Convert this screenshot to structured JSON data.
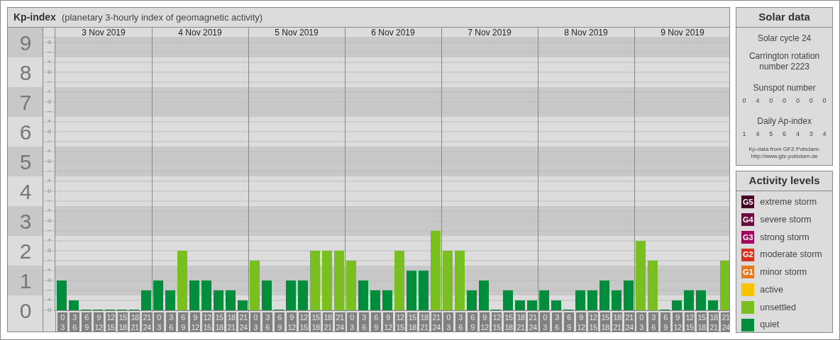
{
  "header": {
    "title": "Kp-index",
    "subtitle": "(planetary 3-hourly index of geomagnetic activity)"
  },
  "chart": {
    "sub_level_marks": [
      "o",
      "−",
      "+",
      "o",
      "−",
      "+",
      "o",
      "−",
      "+",
      "o",
      "−",
      "+",
      "o",
      "−",
      "+",
      "o",
      "−",
      "+",
      "o",
      "−",
      "+",
      "o",
      "−",
      "+",
      "o",
      "−",
      "+",
      "o"
    ],
    "dates": [
      "3 Nov 2019",
      "4 Nov 2019",
      "5 Nov 2019",
      "6 Nov 2019",
      "7 Nov 2019",
      "8 Nov 2019",
      "9 Nov 2019"
    ],
    "hour_labels": [
      [
        "0",
        "3"
      ],
      [
        "3",
        "6"
      ],
      [
        "6",
        "9"
      ],
      [
        "9",
        "12"
      ],
      [
        "12",
        "15"
      ],
      [
        "15",
        "18"
      ],
      [
        "18",
        "21"
      ],
      [
        "21",
        "24"
      ],
      [
        "0",
        "3"
      ],
      [
        "3",
        "6"
      ],
      [
        "6",
        "9"
      ],
      [
        "9",
        "12"
      ],
      [
        "12",
        "15"
      ],
      [
        "15",
        "18"
      ],
      [
        "18",
        "21"
      ],
      [
        "21",
        "24"
      ],
      [
        "0",
        "3"
      ],
      [
        "3",
        "6"
      ],
      [
        "6",
        "9"
      ],
      [
        "9",
        "12"
      ],
      [
        "12",
        "15"
      ],
      [
        "15",
        "18"
      ],
      [
        "18",
        "21"
      ],
      [
        "21",
        "24"
      ],
      [
        "0",
        "3"
      ],
      [
        "3",
        "6"
      ],
      [
        "6",
        "9"
      ],
      [
        "9",
        "12"
      ],
      [
        "12",
        "15"
      ],
      [
        "15",
        "18"
      ],
      [
        "18",
        "21"
      ],
      [
        "21",
        "24"
      ],
      [
        "0",
        "3"
      ],
      [
        "3",
        "6"
      ],
      [
        "6",
        "9"
      ],
      [
        "9",
        "12"
      ],
      [
        "12",
        "15"
      ],
      [
        "15",
        "18"
      ],
      [
        "18",
        "21"
      ],
      [
        "21",
        "24"
      ],
      [
        "0",
        "3"
      ],
      [
        "3",
        "6"
      ],
      [
        "6",
        "9"
      ],
      [
        "9",
        "12"
      ],
      [
        "12",
        "15"
      ],
      [
        "15",
        "18"
      ],
      [
        "18",
        "21"
      ],
      [
        "21",
        "24"
      ],
      [
        "0",
        "3"
      ],
      [
        "3",
        "6"
      ],
      [
        "6",
        "9"
      ],
      [
        "9",
        "12"
      ],
      [
        "12",
        "15"
      ],
      [
        "15",
        "18"
      ],
      [
        "18",
        "21"
      ],
      [
        "21",
        "24"
      ]
    ],
    "chart_data": {
      "type": "bar",
      "grid": true,
      "ylim": [
        0,
        9
      ],
      "yticks": [
        0,
        1,
        2,
        3,
        4,
        5,
        6,
        7,
        8,
        9
      ],
      "series": [
        {
          "color": "#008d3c",
          "values": [
            1,
            0.33,
            0,
            0,
            0,
            0,
            0,
            0.67,
            1,
            0.67,
            null,
            1,
            1,
            0.67,
            0.67,
            0.33,
            null,
            1,
            0,
            1,
            1,
            null,
            null,
            null,
            null,
            1,
            0.67,
            0.67,
            null,
            1.33,
            1.33,
            null,
            null,
            null,
            0.67,
            1,
            0,
            0.67,
            0.33,
            0.33,
            0.67,
            0.33,
            0,
            0.67,
            0.67,
            1,
            0.67,
            1,
            null,
            null,
            0,
            0.33,
            0.67,
            0.67,
            0.33,
            null
          ]
        },
        {
          "color": "#7abf20",
          "values": [
            null,
            null,
            null,
            null,
            null,
            null,
            null,
            null,
            null,
            null,
            2,
            null,
            null,
            null,
            null,
            null,
            1.67,
            null,
            null,
            null,
            null,
            2,
            2,
            2,
            1.67,
            null,
            null,
            null,
            2,
            null,
            null,
            2.67,
            2,
            2,
            null,
            null,
            null,
            null,
            null,
            null,
            null,
            null,
            null,
            null,
            null,
            null,
            null,
            null,
            2.33,
            1.67,
            null,
            null,
            null,
            null,
            null,
            1.67
          ]
        }
      ]
    }
  },
  "solar_data": {
    "title": "Solar data",
    "solar_cycle": "Solar cycle 24",
    "carrington_rotation": "Carrington rotation number 2223",
    "sunspot_label": "Sunspot number",
    "sunspot_numbers": [
      "0",
      "4",
      "0",
      "0",
      "0",
      "0",
      "0"
    ],
    "ap_label": "Daily Ap-index",
    "ap_values": [
      "1",
      "4",
      "5",
      "6",
      "4",
      "3",
      "4"
    ],
    "source": "Kp-data from GFZ Potsdam:",
    "source_url": "http://www.gfz-potsdam.de"
  },
  "activity_levels": {
    "title": "Activity levels",
    "items": [
      {
        "badge": "G5",
        "label": "extreme storm",
        "color": "#4a0024"
      },
      {
        "badge": "G4",
        "label": "severe storm",
        "color": "#6b0a40"
      },
      {
        "badge": "G3",
        "label": "strong storm",
        "color": "#a8005e"
      },
      {
        "badge": "G2",
        "label": "moderate storm",
        "color": "#d8321e"
      },
      {
        "badge": "G1",
        "label": "minor storm",
        "color": "#e8781e"
      },
      {
        "label": "active",
        "color": "#f6c400"
      },
      {
        "label": "unsettled",
        "color": "#7abf20"
      },
      {
        "label": "quiet",
        "color": "#008d3c"
      }
    ]
  }
}
